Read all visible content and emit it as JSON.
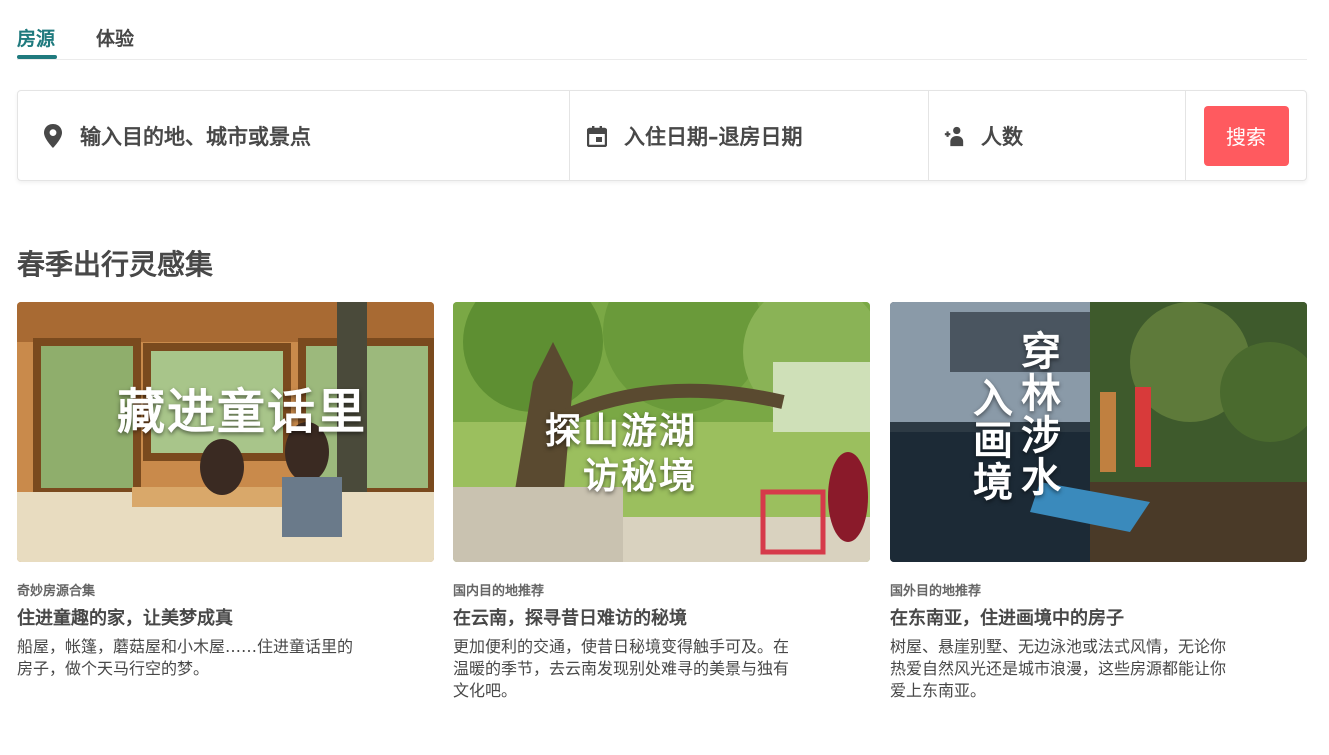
{
  "tabs": [
    {
      "label": "房源",
      "active": true
    },
    {
      "label": "体验",
      "active": false
    }
  ],
  "search": {
    "destination_placeholder": "输入目的地、城市或景点",
    "dates_placeholder": "入住日期–退房日期",
    "guests_placeholder": "人数",
    "button_label": "搜索",
    "icons": [
      "location-pin-icon",
      "calendar-icon",
      "add-guest-icon"
    ],
    "button_color": "#ff5a5f"
  },
  "section": {
    "title": "春季出行灵感集",
    "cards": [
      {
        "kicker": "奇妙房源合集",
        "title": "住进童趣的家，让美梦成真",
        "description": "船屋，帐篷，蘑菇屋和小木屋……住进童话里的房子，做个天马行空的梦。",
        "image_text": "藏进童话里"
      },
      {
        "kicker": "国内目的地推荐",
        "title": "在云南，探寻昔日难访的秘境",
        "description": "更加便利的交通，使昔日秘境变得触手可及。在温暖的季节，去云南发现别处难寻的美景与独有文化吧。",
        "image_text_line1": "探山游湖",
        "image_text_line2": "访秘境"
      },
      {
        "kicker": "国外目的地推荐",
        "title": "在东南亚，住进画境中的房子",
        "description": "树屋、悬崖别墅、无边泳池或法式风情，无论你热爱自然风光还是城市浪漫，这些房源都能让你爱上东南亚。",
        "image_text_col1": "穿林涉水",
        "image_text_col2": "入画境"
      }
    ]
  },
  "colors": {
    "accent": "#1f7a7e",
    "text": "#484848"
  }
}
